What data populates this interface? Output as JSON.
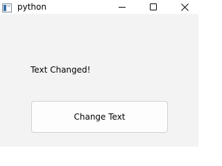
{
  "window": {
    "title": "python",
    "icon": "python-app-icon"
  },
  "title_controls": {
    "minimize_icon": "minimize-icon",
    "maximize_icon": "maximize-icon",
    "close_icon": "close-icon"
  },
  "main": {
    "label_text": "Text Changed!",
    "button_label": "Change Text"
  },
  "colors": {
    "background": "#f3f3f3",
    "titlebar": "#ffffff",
    "button_bg": "#fdfdfd",
    "button_border": "#d0d0d0"
  }
}
